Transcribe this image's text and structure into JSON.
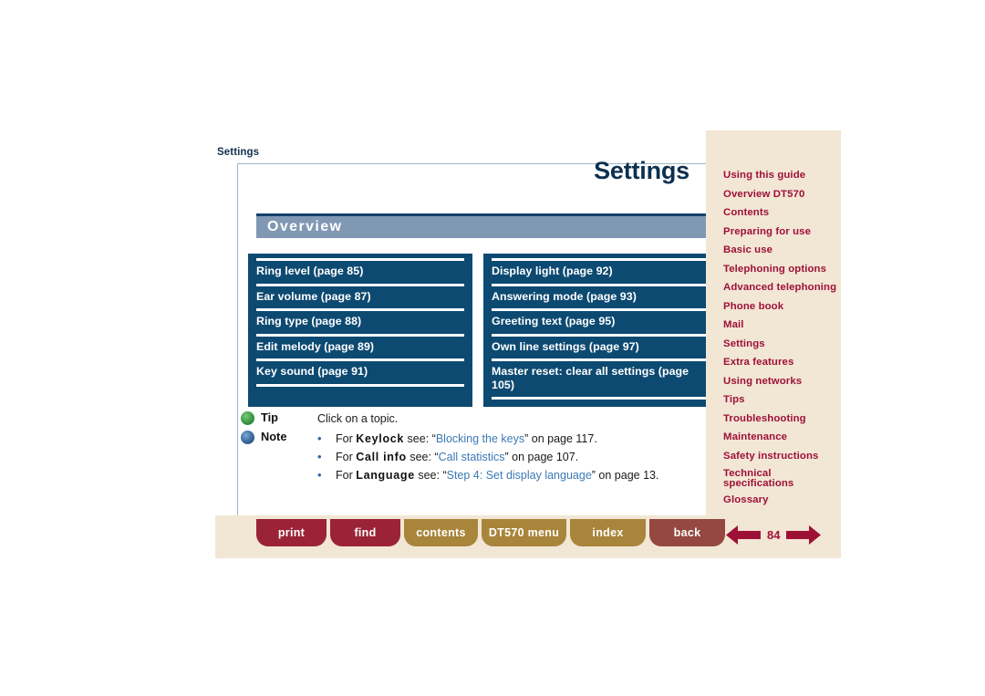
{
  "document": {
    "breadcrumb": "Settings",
    "page_title": "Settings",
    "section_title": "Overview",
    "page_number": "84"
  },
  "topics": {
    "left_column": [
      {
        "label": "Ring level (page 85)"
      },
      {
        "label": "Ear volume (page 87)"
      },
      {
        "label": "Ring type (page 88)"
      },
      {
        "label": "Edit melody (page 89)"
      },
      {
        "label": "Key sound (page 91)"
      }
    ],
    "right_column": [
      {
        "label": "Display light (page 92)"
      },
      {
        "label": "Answering mode (page 93)"
      },
      {
        "label": "Greeting text (page 95)"
      },
      {
        "label": "Own line settings (page 97)"
      },
      {
        "label": "Master reset: clear all settings (page 105)"
      }
    ]
  },
  "notes": {
    "tip_label": "Tip",
    "tip_text": "Click on a topic.",
    "note_label": "Note",
    "bullet_glyph": "•",
    "items": [
      {
        "prefix": "For ",
        "keyword": "Keylock",
        "middle": " see: ",
        "quote_open": "“",
        "link": "Blocking the keys",
        "quote_close": "”",
        "suffix": " on page 117."
      },
      {
        "prefix": "For ",
        "keyword": "Call info",
        "middle": " see: ",
        "quote_open": "“",
        "link": "Call statistics",
        "quote_close": "”",
        "suffix": " on page 107."
      },
      {
        "prefix": "For ",
        "keyword": "Language",
        "middle": " see: ",
        "quote_open": "“",
        "link": "Step 4: Set display language",
        "quote_close": "”",
        "suffix": " on page 13."
      }
    ]
  },
  "sidebar": {
    "items": [
      {
        "label": "Using this guide",
        "lines": null
      },
      {
        "label": "Overview DT570",
        "lines": null
      },
      {
        "label": "Contents",
        "lines": null
      },
      {
        "label": "Preparing for use",
        "lines": null
      },
      {
        "label": "Basic use",
        "lines": null
      },
      {
        "label": "Telephoning options",
        "lines": null
      },
      {
        "label": "Advanced telephoning",
        "lines": null
      },
      {
        "label": "Phone book",
        "lines": null
      },
      {
        "label": "Mail",
        "lines": null
      },
      {
        "label": "Settings",
        "lines": null
      },
      {
        "label": "Extra features",
        "lines": null
      },
      {
        "label": "Using networks",
        "lines": null
      },
      {
        "label": "Tips",
        "lines": null
      },
      {
        "label": "Troubleshooting",
        "lines": null
      },
      {
        "label": "Maintenance",
        "lines": null
      },
      {
        "label": "Safety instructions",
        "lines": null
      },
      {
        "label": "Technical specifications",
        "line1": "Technical",
        "line2": "specifications"
      },
      {
        "label": "Glossary",
        "lines": null
      }
    ]
  },
  "footer": {
    "buttons": [
      {
        "label": "print"
      },
      {
        "label": "find"
      },
      {
        "label": "contents"
      },
      {
        "label": "DT570 menu"
      },
      {
        "label": "index"
      },
      {
        "label": "back"
      }
    ]
  },
  "colors": {
    "topic_box": "#0d4a72",
    "section_bar": "#8098b4",
    "sidebar_bg": "#f2e6d5",
    "sidebar_text": "#9e1137",
    "link": "#3b7ab5",
    "title": "#0d3050"
  }
}
